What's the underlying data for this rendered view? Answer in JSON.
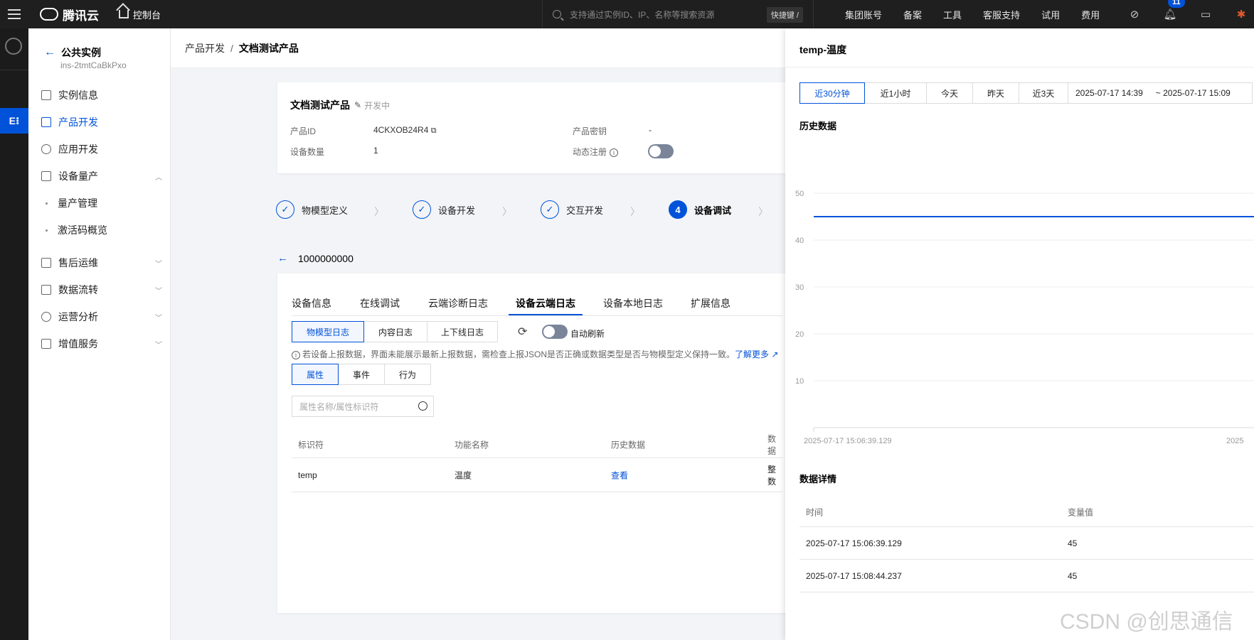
{
  "topbar": {
    "brand": "腾讯云",
    "console": "控制台",
    "search_placeholder": "支持通过实例ID、IP、名称等搜索资源",
    "shortcut": "快捷键 /",
    "nav": [
      "集团账号",
      "备案",
      "工具",
      "客服支持",
      "试用",
      "费用"
    ],
    "notification_count": "11",
    "accent": "#0052d9"
  },
  "rail": {
    "active_label": "E⁝"
  },
  "sidebar": {
    "back_title": "公共实例",
    "instance_id": "ins-2tmtCaBkPxo",
    "items": [
      {
        "label": "实例信息"
      },
      {
        "label": "产品开发"
      },
      {
        "label": "应用开发"
      },
      {
        "label": "设备量产"
      },
      {
        "label": "售后运维"
      },
      {
        "label": "数据流转"
      },
      {
        "label": "运营分析"
      },
      {
        "label": "增值服务"
      }
    ],
    "children": [
      "量产管理",
      "激活码概览"
    ]
  },
  "breadcrumb": {
    "parent": "产品开发",
    "sep": "/",
    "current": "文档测试产品"
  },
  "product": {
    "name": "文档测试产品",
    "status": "开发中",
    "id_label": "产品ID",
    "id_value": "4CKXOB24R4",
    "secret_label": "产品密钥",
    "secret_value": "-",
    "devices_label": "设备数量",
    "devices_value": "1",
    "dynreg_label": "动态注册"
  },
  "steps": [
    {
      "label": "物模型定义",
      "mark": "✓"
    },
    {
      "label": "设备开发",
      "mark": "✓"
    },
    {
      "label": "交互开发",
      "mark": "✓"
    },
    {
      "label": "设备调试",
      "mark": "4"
    }
  ],
  "device": {
    "name": "1000000000",
    "tabs": [
      "设备信息",
      "在线调试",
      "云端诊断日志",
      "设备云端日志",
      "设备本地日志",
      "扩展信息"
    ],
    "log_types": [
      "物模型日志",
      "内容日志",
      "上下线日志"
    ],
    "auto_refresh": "自动刷新",
    "tip": "若设备上报数据，界面未能展示最新上报数据，需检查上报JSON是否正确或数据类型是否与物模型定义保持一致。",
    "tip_link": "了解更多",
    "categories": [
      "属性",
      "事件",
      "行为"
    ],
    "search_placeholder": "属性名称/属性标识符",
    "columns": [
      "标识符",
      "功能名称",
      "历史数据",
      "数据"
    ],
    "row": {
      "id": "temp",
      "name": "温度",
      "history": "查看",
      "type": "整数"
    }
  },
  "drawer": {
    "title": "temp-温度",
    "ranges": [
      "近30分钟",
      "近1小时",
      "今天",
      "昨天",
      "近3天"
    ],
    "date_from": "2025-07-17 14:39",
    "date_to": "~ 2025-07-17 15:09",
    "history_title": "历史数据",
    "details_title": "数据详情",
    "columns": [
      "时间",
      "变量值"
    ],
    "rows": [
      {
        "time": "2025-07-17 15:06:39.129",
        "value": "45"
      },
      {
        "time": "2025-07-17 15:08:44.237",
        "value": "45"
      }
    ]
  },
  "chart_data": {
    "type": "line",
    "x": [
      "2025-07-17 15:06:39.129",
      "2025-07-17 15:08:44.237"
    ],
    "series": [
      {
        "values": [
          45,
          45
        ]
      }
    ],
    "y_ticks": [
      10,
      20,
      30,
      40,
      50
    ],
    "x_tick_labels": [
      "2025-07-17 15:06:39.129",
      "2025"
    ],
    "ylim": [
      0,
      50
    ],
    "grid": true,
    "line_color": "#0052d9"
  },
  "watermark": "CSDN @创思通信"
}
